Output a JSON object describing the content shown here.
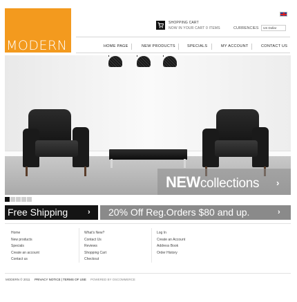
{
  "brand": {
    "logo_text": "MODERN",
    "accent_color": "#f39a1e"
  },
  "header": {
    "language_flag": "uk-flag-icon",
    "cart": {
      "icon": "cart-icon",
      "title": "SHOPPING CART",
      "status": "NOW IN YOUR CART 0 ITEMS"
    },
    "currencies": {
      "label": "CURRENCIES",
      "selected": "US Dollar"
    }
  },
  "nav": {
    "items": [
      "HOME PAGE",
      "NEW PRODUCTS",
      "SPECIALS",
      "MY ACCOUNT",
      "CONTACT US"
    ]
  },
  "hero": {
    "headline_bold": "NEW",
    "headline_rest": "collections",
    "arrow": "›",
    "slides_total": 5,
    "slide_active": 1
  },
  "promos": {
    "left": {
      "text": "Free Shipping",
      "arrow": "›",
      "color": "#141414"
    },
    "right": {
      "text": "20% Off Reg.Orders $80 and up.",
      "arrow": "›",
      "color": "#8a8a8a"
    }
  },
  "footer": {
    "col1": [
      "Home",
      "New products",
      "Specials",
      "Create an account",
      "Contact us"
    ],
    "col2": [
      "What's New?",
      "Contact Us",
      "Reviews",
      "Shopping Cart",
      "Checkout"
    ],
    "col3": [
      "Log In",
      "Create an Account",
      "Address Book",
      "Order History"
    ],
    "copyright": "MODERN © 2011",
    "links": "PRIVACY NOTICE  |  TERMS OF USE",
    "powered": "POWERED BY OSCOMMERCE"
  }
}
